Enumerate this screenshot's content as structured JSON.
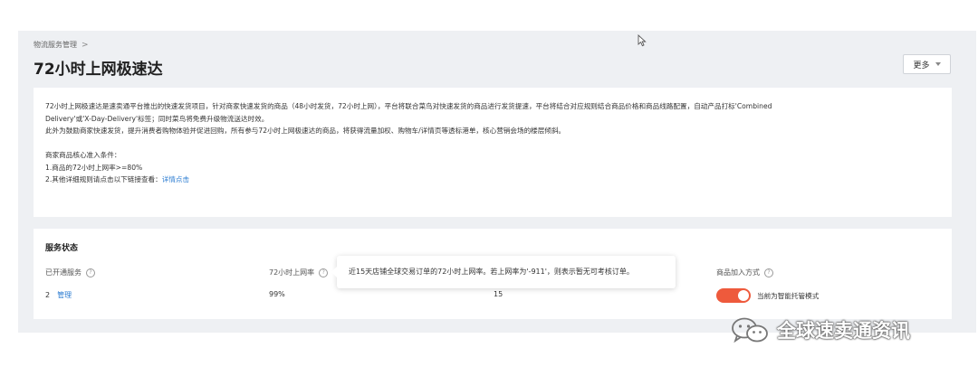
{
  "breadcrumb": {
    "item": "物流服务管理",
    "separator": ">"
  },
  "page": {
    "title": "72小时上网极速达",
    "more_label": "更多"
  },
  "intro": {
    "line1": "72小时上网极速达是速卖通平台推出的快速发货项目，针对商家快速发货的商品（48小时发货，72小时上网），平台将联合菜鸟对快速发货的商品进行发货提速，平台将结合对应规则结合商品价格和商品线路配置，自动产品打标'Combined",
    "line2": "Delivery'或'X-Day-Delivery'标签；同时菜鸟将免费升级物流送达时效。",
    "line3": "此外为鼓励商家快速发货，提升消费者购物体验并促进回购，所有参与72小时上网极速达的商品，将获得流量加权、购物车/详情页等透标港单，核心营销会场的楼层倾斜。",
    "criteria_title": "商家商品核心准入条件：",
    "criteria_1": "1.商品的72小时上网率>=80%",
    "criteria_2_prefix": "2.其他详细规则请点击以下链接查看：",
    "criteria_2_link": "详情点击"
  },
  "service_status": {
    "title": "服务状态",
    "opened_label": "已开通服务",
    "opened_value": "2",
    "manage_link": "管理",
    "rate_label": "72小时上网率",
    "rate_value": "99%",
    "third_value": "15",
    "join_label": "商品加入方式",
    "toggle_label": "当前为智能托管模式",
    "toggle_on": true,
    "accent_color": "#ee5a3c"
  },
  "tooltip": {
    "text": "近15天店铺全球交易订单的72小时上网率。若上网率为'-911'，则表示暂无可考核订单。"
  },
  "watermark": {
    "text": "全球速卖通资讯"
  }
}
